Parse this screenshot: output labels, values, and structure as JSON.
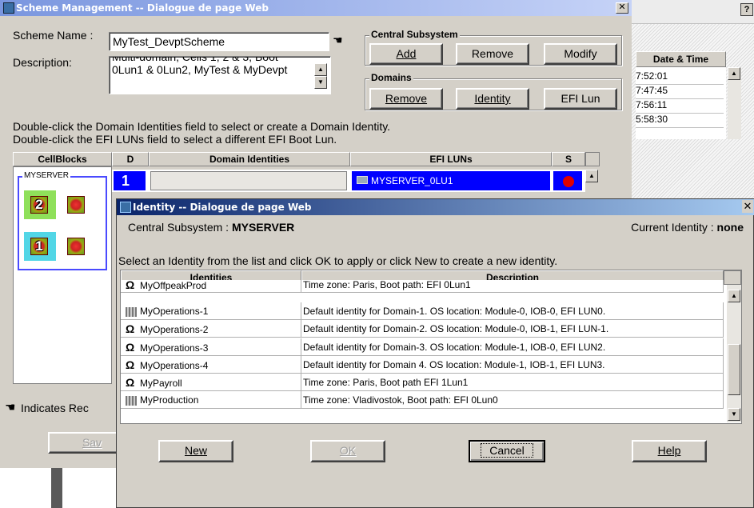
{
  "scheme_window": {
    "title": "Scheme Management -- Dialogue de page Web",
    "scheme_name_label": "Scheme Name :",
    "scheme_name_value": "MyTest_DevptScheme",
    "description_label": "Description:",
    "description_value": "Multi-domain, Cells 1, 2 & 3, Boot 0Lun1 & 0Lun2, MyTest & MyDevpt",
    "central_subsystem_label": "Central Subsystem",
    "add_label": "Add",
    "remove_label": "Remove",
    "modify_label": "Modify",
    "domains_label": "Domains",
    "domains_remove_label": "Remove",
    "identity_label": "Identity",
    "efi_lun_label": "EFI Lun",
    "instruction_1": "Double-click the Domain Identities field to select or create a Domain Identity.",
    "instruction_2": "Double-click the EFI LUNs field to select a different EFI Boot Lun.",
    "columns": {
      "cellblocks": "CellBlocks",
      "d": "D",
      "domain_identities": "Domain Identities",
      "efi_luns": "EFI LUNs",
      "s": "S"
    },
    "server_name": "MYSERVER",
    "row": {
      "d": "1",
      "efi_lun": "MYSERVER_0LU1"
    },
    "chips": [
      "2",
      "",
      "1",
      ""
    ],
    "legend_text": "Indicates Rec",
    "save_label": "Sav"
  },
  "background_window": {
    "date_time_header": "Date & Time",
    "times": [
      "7:52:01",
      "7:47:45",
      "7:56:11",
      "5:58:30"
    ]
  },
  "identity_dialog": {
    "title": "Identity -- Dialogue de page Web",
    "central_subsystem_label": "Central Subsystem :",
    "central_subsystem_value": "MYSERVER",
    "current_identity_label": "Current Identity :",
    "current_identity_value": "none",
    "instruction": "Select an Identity from the list and click OK to apply or click New to create a new identity.",
    "col_identities": "Identities",
    "col_description": "Description",
    "rows": [
      {
        "name": "MyOffpeakProd",
        "icon": "hp-ux-icon",
        "desc": "Time zone: Paris, Boot path: EFI 0Lun1"
      },
      {
        "name": "MyOperations-1",
        "icon": "windows-icon",
        "desc": "Default identity for Domain-1. OS location: Module-0, IOB-0, EFI LUN0."
      },
      {
        "name": "MyOperations-2",
        "icon": "hp-ux-icon",
        "desc": "Default identity for Domain-2. OS location: Module-0, IOB-1, EFI LUN-1."
      },
      {
        "name": "MyOperations-3",
        "icon": "hp-ux-icon",
        "desc": "Default identity for Domain-3. OS location: Module-1, IOB-0, EFI LUN2."
      },
      {
        "name": "MyOperations-4",
        "icon": "hp-ux-icon",
        "desc": "Default identity for Domain 4. OS location: Module-1, IOB-1, EFI LUN3."
      },
      {
        "name": "MyPayroll",
        "icon": "hp-ux-icon",
        "desc": "Time zone: Paris, Boot path EFI 1Lun1"
      },
      {
        "name": "MyProduction",
        "icon": "windows-icon",
        "desc": "Time zone: Vladivostok, Boot path: EFI 0Lun0"
      }
    ],
    "new_label": "New",
    "ok_label": "OK",
    "cancel_label": "Cancel",
    "help_label": "Help"
  },
  "colors": {
    "title_active": "#0a246a",
    "selection_blue": "#0000ff",
    "dialog_face": "#d4d0c8"
  }
}
